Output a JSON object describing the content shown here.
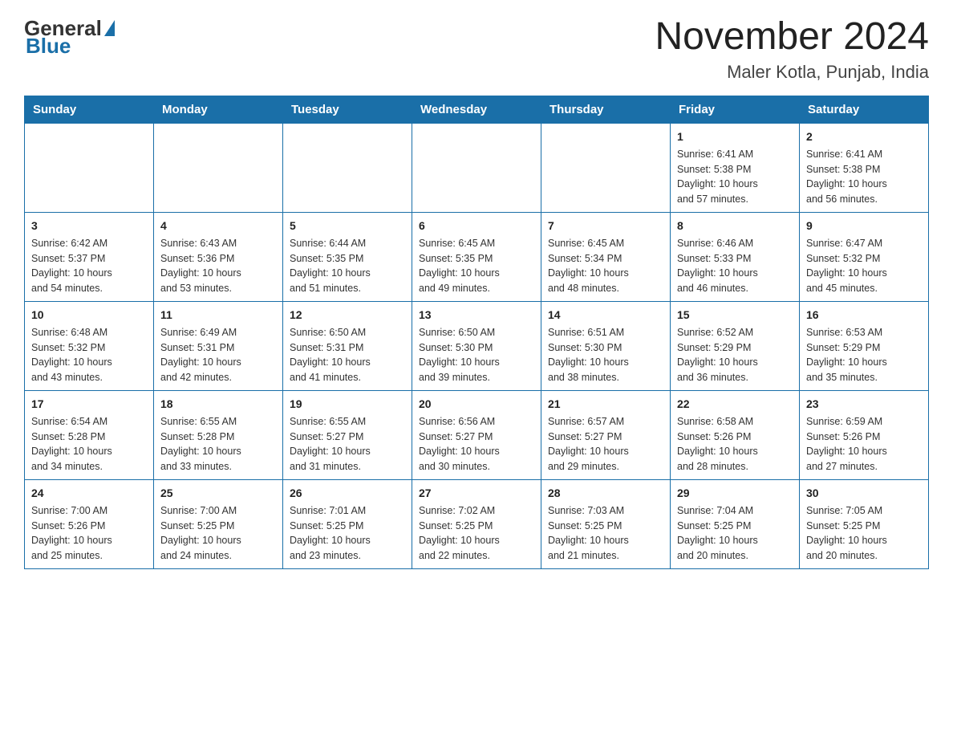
{
  "header": {
    "logo_general": "General",
    "logo_blue": "Blue",
    "main_title": "November 2024",
    "sub_title": "Maler Kotla, Punjab, India"
  },
  "calendar": {
    "days": [
      "Sunday",
      "Monday",
      "Tuesday",
      "Wednesday",
      "Thursday",
      "Friday",
      "Saturday"
    ],
    "weeks": [
      [
        {
          "day": "",
          "lines": []
        },
        {
          "day": "",
          "lines": []
        },
        {
          "day": "",
          "lines": []
        },
        {
          "day": "",
          "lines": []
        },
        {
          "day": "",
          "lines": []
        },
        {
          "day": "1",
          "lines": [
            "Sunrise: 6:41 AM",
            "Sunset: 5:38 PM",
            "Daylight: 10 hours",
            "and 57 minutes."
          ]
        },
        {
          "day": "2",
          "lines": [
            "Sunrise: 6:41 AM",
            "Sunset: 5:38 PM",
            "Daylight: 10 hours",
            "and 56 minutes."
          ]
        }
      ],
      [
        {
          "day": "3",
          "lines": [
            "Sunrise: 6:42 AM",
            "Sunset: 5:37 PM",
            "Daylight: 10 hours",
            "and 54 minutes."
          ]
        },
        {
          "day": "4",
          "lines": [
            "Sunrise: 6:43 AM",
            "Sunset: 5:36 PM",
            "Daylight: 10 hours",
            "and 53 minutes."
          ]
        },
        {
          "day": "5",
          "lines": [
            "Sunrise: 6:44 AM",
            "Sunset: 5:35 PM",
            "Daylight: 10 hours",
            "and 51 minutes."
          ]
        },
        {
          "day": "6",
          "lines": [
            "Sunrise: 6:45 AM",
            "Sunset: 5:35 PM",
            "Daylight: 10 hours",
            "and 49 minutes."
          ]
        },
        {
          "day": "7",
          "lines": [
            "Sunrise: 6:45 AM",
            "Sunset: 5:34 PM",
            "Daylight: 10 hours",
            "and 48 minutes."
          ]
        },
        {
          "day": "8",
          "lines": [
            "Sunrise: 6:46 AM",
            "Sunset: 5:33 PM",
            "Daylight: 10 hours",
            "and 46 minutes."
          ]
        },
        {
          "day": "9",
          "lines": [
            "Sunrise: 6:47 AM",
            "Sunset: 5:32 PM",
            "Daylight: 10 hours",
            "and 45 minutes."
          ]
        }
      ],
      [
        {
          "day": "10",
          "lines": [
            "Sunrise: 6:48 AM",
            "Sunset: 5:32 PM",
            "Daylight: 10 hours",
            "and 43 minutes."
          ]
        },
        {
          "day": "11",
          "lines": [
            "Sunrise: 6:49 AM",
            "Sunset: 5:31 PM",
            "Daylight: 10 hours",
            "and 42 minutes."
          ]
        },
        {
          "day": "12",
          "lines": [
            "Sunrise: 6:50 AM",
            "Sunset: 5:31 PM",
            "Daylight: 10 hours",
            "and 41 minutes."
          ]
        },
        {
          "day": "13",
          "lines": [
            "Sunrise: 6:50 AM",
            "Sunset: 5:30 PM",
            "Daylight: 10 hours",
            "and 39 minutes."
          ]
        },
        {
          "day": "14",
          "lines": [
            "Sunrise: 6:51 AM",
            "Sunset: 5:30 PM",
            "Daylight: 10 hours",
            "and 38 minutes."
          ]
        },
        {
          "day": "15",
          "lines": [
            "Sunrise: 6:52 AM",
            "Sunset: 5:29 PM",
            "Daylight: 10 hours",
            "and 36 minutes."
          ]
        },
        {
          "day": "16",
          "lines": [
            "Sunrise: 6:53 AM",
            "Sunset: 5:29 PM",
            "Daylight: 10 hours",
            "and 35 minutes."
          ]
        }
      ],
      [
        {
          "day": "17",
          "lines": [
            "Sunrise: 6:54 AM",
            "Sunset: 5:28 PM",
            "Daylight: 10 hours",
            "and 34 minutes."
          ]
        },
        {
          "day": "18",
          "lines": [
            "Sunrise: 6:55 AM",
            "Sunset: 5:28 PM",
            "Daylight: 10 hours",
            "and 33 minutes."
          ]
        },
        {
          "day": "19",
          "lines": [
            "Sunrise: 6:55 AM",
            "Sunset: 5:27 PM",
            "Daylight: 10 hours",
            "and 31 minutes."
          ]
        },
        {
          "day": "20",
          "lines": [
            "Sunrise: 6:56 AM",
            "Sunset: 5:27 PM",
            "Daylight: 10 hours",
            "and 30 minutes."
          ]
        },
        {
          "day": "21",
          "lines": [
            "Sunrise: 6:57 AM",
            "Sunset: 5:27 PM",
            "Daylight: 10 hours",
            "and 29 minutes."
          ]
        },
        {
          "day": "22",
          "lines": [
            "Sunrise: 6:58 AM",
            "Sunset: 5:26 PM",
            "Daylight: 10 hours",
            "and 28 minutes."
          ]
        },
        {
          "day": "23",
          "lines": [
            "Sunrise: 6:59 AM",
            "Sunset: 5:26 PM",
            "Daylight: 10 hours",
            "and 27 minutes."
          ]
        }
      ],
      [
        {
          "day": "24",
          "lines": [
            "Sunrise: 7:00 AM",
            "Sunset: 5:26 PM",
            "Daylight: 10 hours",
            "and 25 minutes."
          ]
        },
        {
          "day": "25",
          "lines": [
            "Sunrise: 7:00 AM",
            "Sunset: 5:25 PM",
            "Daylight: 10 hours",
            "and 24 minutes."
          ]
        },
        {
          "day": "26",
          "lines": [
            "Sunrise: 7:01 AM",
            "Sunset: 5:25 PM",
            "Daylight: 10 hours",
            "and 23 minutes."
          ]
        },
        {
          "day": "27",
          "lines": [
            "Sunrise: 7:02 AM",
            "Sunset: 5:25 PM",
            "Daylight: 10 hours",
            "and 22 minutes."
          ]
        },
        {
          "day": "28",
          "lines": [
            "Sunrise: 7:03 AM",
            "Sunset: 5:25 PM",
            "Daylight: 10 hours",
            "and 21 minutes."
          ]
        },
        {
          "day": "29",
          "lines": [
            "Sunrise: 7:04 AM",
            "Sunset: 5:25 PM",
            "Daylight: 10 hours",
            "and 20 minutes."
          ]
        },
        {
          "day": "30",
          "lines": [
            "Sunrise: 7:05 AM",
            "Sunset: 5:25 PM",
            "Daylight: 10 hours",
            "and 20 minutes."
          ]
        }
      ]
    ]
  }
}
